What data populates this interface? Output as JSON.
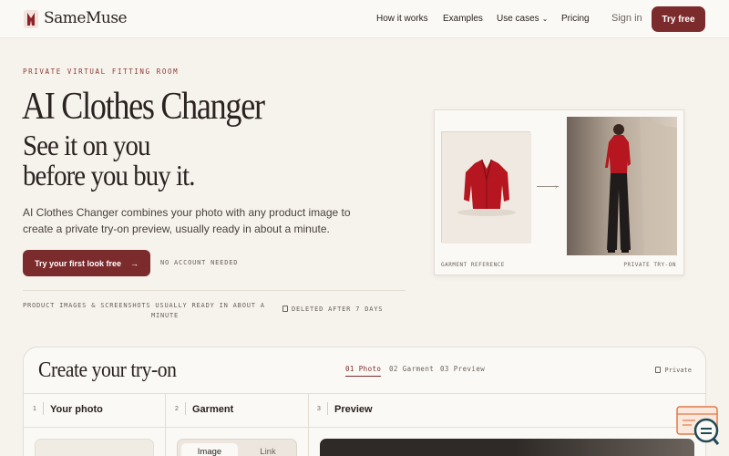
{
  "nav": {
    "brand": "SameMuse",
    "links": [
      "How it works",
      "Examples",
      "Use cases",
      "Pricing"
    ],
    "sign_in": "Sign in",
    "try_free": "Try free"
  },
  "hero": {
    "eyebrow": "PRIVATE VIRTUAL FITTING ROOM",
    "title": "AI Clothes Changer",
    "subtitle_1": "See it on you",
    "subtitle_2": "before you buy it.",
    "description": "AI Clothes Changer combines your photo with any product image to create a private try-on preview, usually ready in about a minute.",
    "cta": "Try your first look free",
    "cta_arrow": "→",
    "no_account": "NO ACCOUNT NEEDED",
    "note_1a": "PRODUCT IMAGES & SCREENSHOTS USUALLY READY IN ABOUT A",
    "note_1b": "MINUTE",
    "note_2": "DELETED AFTER 7 DAYS"
  },
  "preview_card": {
    "left_label": "GARMENT REFERENCE",
    "right_label": "PRIVATE TRY-ON"
  },
  "tryon": {
    "title": "Create your try-on",
    "steps": [
      "01 Photo",
      "02 Garment",
      "03 Preview"
    ],
    "private": "Private",
    "columns": [
      {
        "num": "1",
        "title": "Your photo"
      },
      {
        "num": "2",
        "title": "Garment"
      },
      {
        "num": "3",
        "title": "Preview"
      }
    ],
    "segment": {
      "image": "Image",
      "link": "Link"
    }
  },
  "colors": {
    "accent": "#7c2b2c",
    "background": "#f6f2ec",
    "blazer": "#b5161f"
  }
}
